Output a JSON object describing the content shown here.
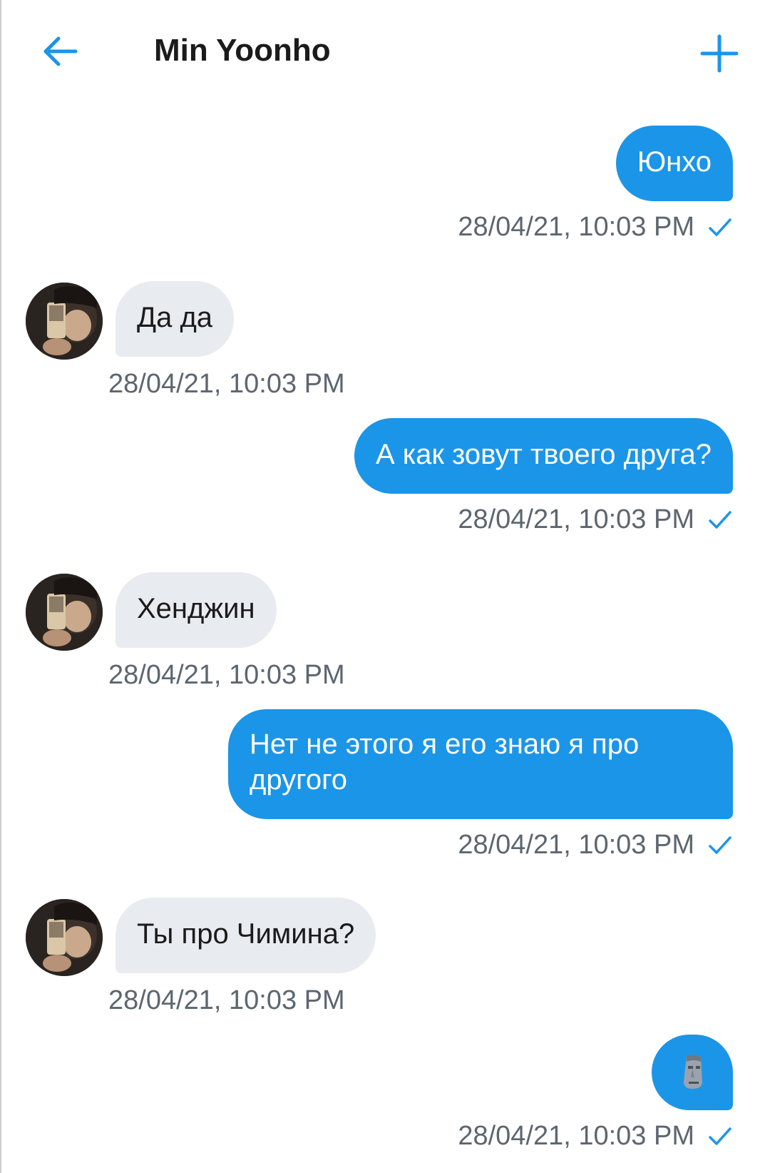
{
  "header": {
    "title": "Min Yoonho",
    "back_icon": "arrow-left-icon",
    "add_icon": "plus-icon",
    "accent_color": "#1b95e8"
  },
  "messages": [
    {
      "direction": "outgoing",
      "text": "Юнхо",
      "timestamp": "28/04/21, 10:03 PM",
      "status_icon": "check-icon"
    },
    {
      "direction": "incoming",
      "text": "Да да",
      "timestamp": "28/04/21, 10:03 PM",
      "avatar_icon": "avatar-photo"
    },
    {
      "direction": "outgoing",
      "text": "А как зовут твоего друга?",
      "timestamp": "28/04/21, 10:03 PM",
      "status_icon": "check-icon"
    },
    {
      "direction": "incoming",
      "text": "Хенджин",
      "timestamp": "28/04/21, 10:03 PM",
      "avatar_icon": "avatar-photo"
    },
    {
      "direction": "outgoing",
      "text": "Нет не этого я его знаю я про другого",
      "timestamp": "28/04/21, 10:03 PM",
      "status_icon": "check-icon"
    },
    {
      "direction": "incoming",
      "text": "Ты про Чимина?",
      "timestamp": "28/04/21, 10:03 PM",
      "avatar_icon": "avatar-photo"
    },
    {
      "direction": "outgoing",
      "text": "",
      "emoji_icon": "moai-emoji-icon",
      "timestamp": "28/04/21, 10:03 PM",
      "status_icon": "check-icon"
    }
  ],
  "colors": {
    "outgoing_bubble": "#1b95e8",
    "incoming_bubble": "#e8ebf0",
    "timestamp_text": "#5c6670"
  }
}
